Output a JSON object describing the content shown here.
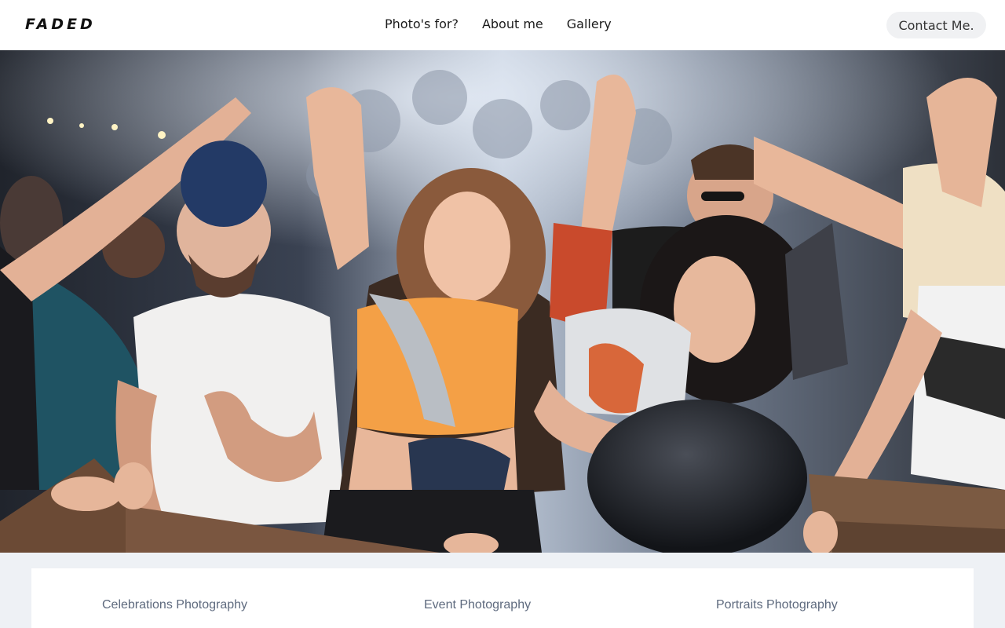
{
  "brand": {
    "logo": "FADED"
  },
  "nav": {
    "items": [
      {
        "label": "Photo's for?"
      },
      {
        "label": "About me"
      },
      {
        "label": "Gallery"
      }
    ],
    "contact_label": "Contact Me."
  },
  "hero": {
    "image_subject": "crowd of people dancing at a festival concert",
    "colors": {
      "orange_top": "#f4a046",
      "white_shirt": "#f1f0ef",
      "teal_shirt": "#1f5363",
      "backdrop": "#c9d2df"
    }
  },
  "services": {
    "items": [
      {
        "label": "Celebrations Photography"
      },
      {
        "label": "Event Photography"
      },
      {
        "label": "Portraits Photography"
      }
    ]
  }
}
